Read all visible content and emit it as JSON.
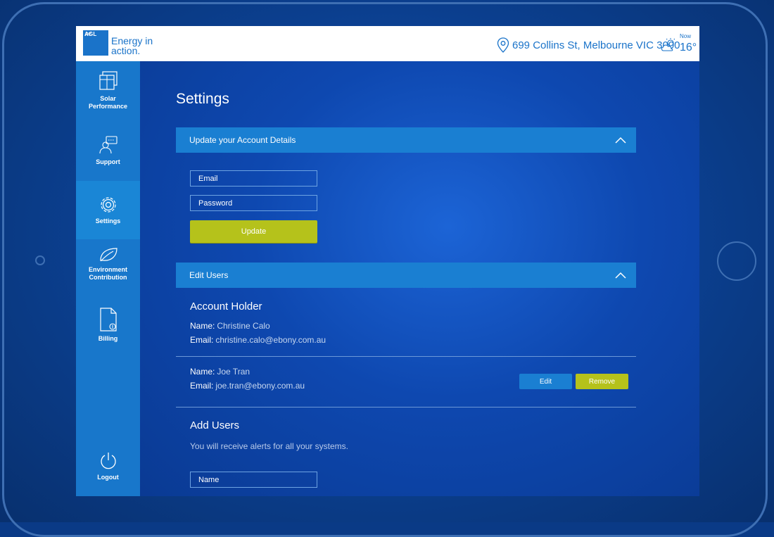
{
  "brand": {
    "logo_mark": "AGL",
    "tagline_line1": "Energy in",
    "tagline_line2": "action."
  },
  "header": {
    "address": "699 Collins St, Melbourne VIC 3000",
    "weather_label": "Now",
    "temperature": "16°",
    "location_icon": "location-pin-icon",
    "weather_icon": "partly-cloudy-icon"
  },
  "sidebar": {
    "items": [
      {
        "label_line1": "Solar",
        "label_line2": "Performance",
        "icon": "solar-panel-icon"
      },
      {
        "label_line1": "Support",
        "label_line2": "",
        "icon": "support-agent-icon"
      },
      {
        "label_line1": "Settings",
        "label_line2": "",
        "icon": "gear-icon",
        "active": true
      },
      {
        "label_line1": "Environment",
        "label_line2": "Contribution",
        "icon": "leaf-icon"
      },
      {
        "label_line1": "Billing",
        "label_line2": "",
        "icon": "bill-icon"
      }
    ],
    "logout_label": "Logout"
  },
  "main": {
    "title": "Settings",
    "account_section": {
      "title": "Update your Account Details",
      "email_placeholder": "Email",
      "password_placeholder": "Password",
      "update_label": "Update"
    },
    "users_section": {
      "title": "Edit Users",
      "account_holder_heading": "Account Holder",
      "holder": {
        "name_label": "Name:",
        "name": "Christine Calo",
        "email_label": "Email:",
        "email": "christine.calo@ebony.com.au"
      },
      "user": {
        "name_label": "Name:",
        "name": "Joe Tran",
        "email_label": "Email:",
        "email": "joe.tran@ebony.com.au",
        "edit_label": "Edit",
        "remove_label": "Remove"
      }
    },
    "add_users": {
      "heading": "Add Users",
      "note": "You will receive alerts for all your systems.",
      "name_placeholder": "Name"
    }
  },
  "colors": {
    "accent_blue": "#1a7fd2",
    "accent_green": "#b5c21b",
    "sidebar_blue": "#1877cb"
  }
}
